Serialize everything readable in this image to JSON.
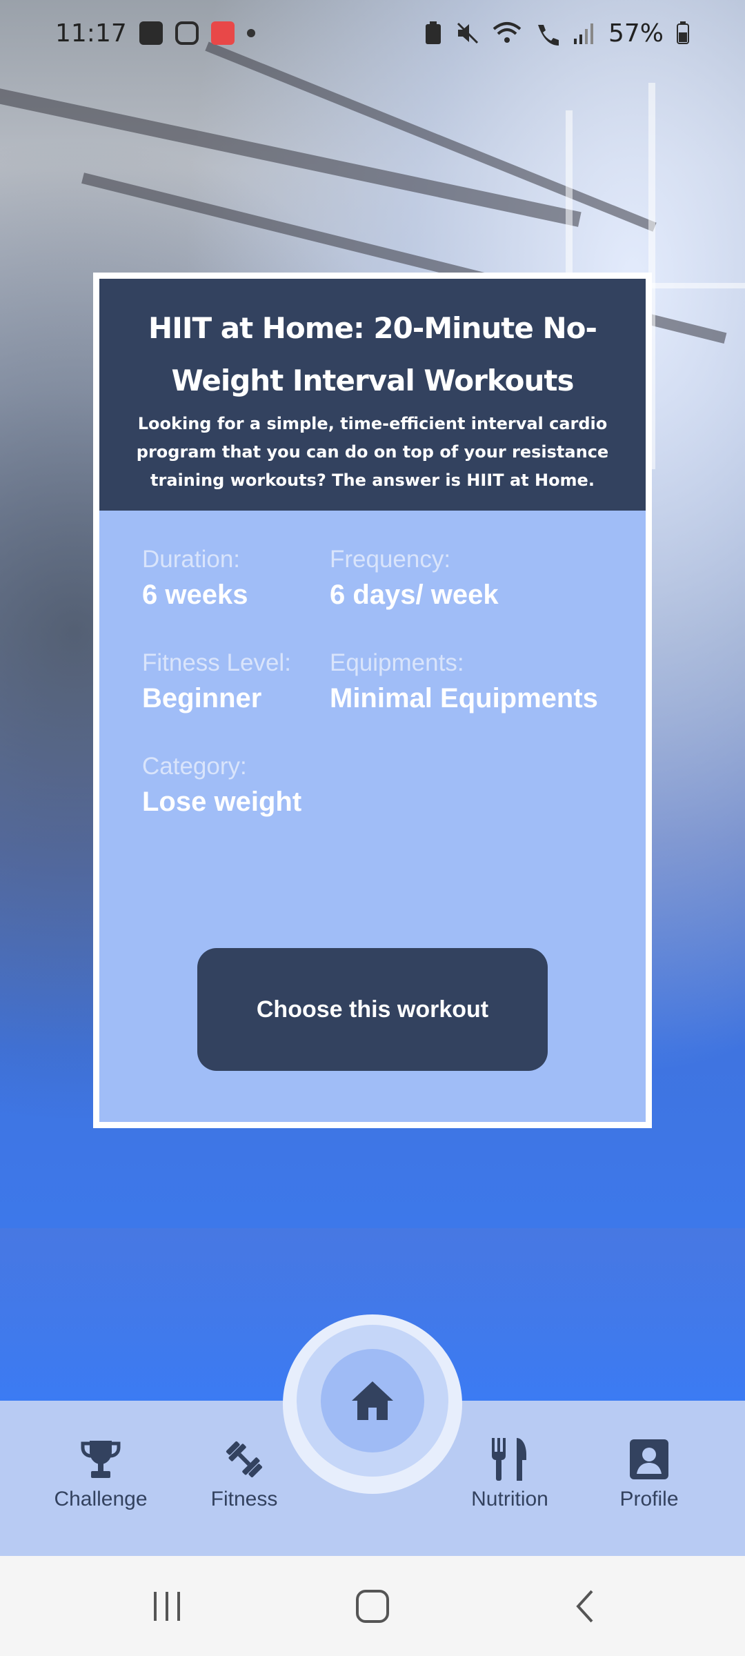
{
  "status_bar": {
    "time": "11:17",
    "battery": "57%",
    "icons_left": [
      "gallery-icon",
      "instagram-icon",
      "app-notification-icon",
      "dot-icon"
    ],
    "icons_right": [
      "battery-saver-icon",
      "mute-icon",
      "wifi-icon",
      "wifi-call-icon",
      "signal-icon",
      "battery-icon"
    ]
  },
  "workout": {
    "title": "HIIT at Home: 20-Minute No-Weight Interval Workouts",
    "description": "Looking for a simple, time-efficient interval cardio program that you can do on top of your resistance training workouts? The answer is HIIT at Home.",
    "duration_label": "Duration:",
    "duration_value": "6 weeks",
    "frequency_label": "Frequency:",
    "frequency_value": "6 days/ week",
    "level_label": "Fitness Level:",
    "level_value": "Beginner",
    "equipment_label": "Equipments:",
    "equipment_value": "Minimal Equipments",
    "category_label": "Category:",
    "category_value": "Lose weight",
    "choose_button": "Choose this workout"
  },
  "bottom_nav": {
    "challenge": "Challenge",
    "fitness": "Fitness",
    "nutrition": "Nutrition",
    "profile": "Profile",
    "home_icon": "home-icon"
  },
  "colors": {
    "card_header": "#33425f",
    "card_body": "#a0bdf7",
    "nav_bg": "#b8cbf3",
    "accent": "#3b7cf0"
  }
}
